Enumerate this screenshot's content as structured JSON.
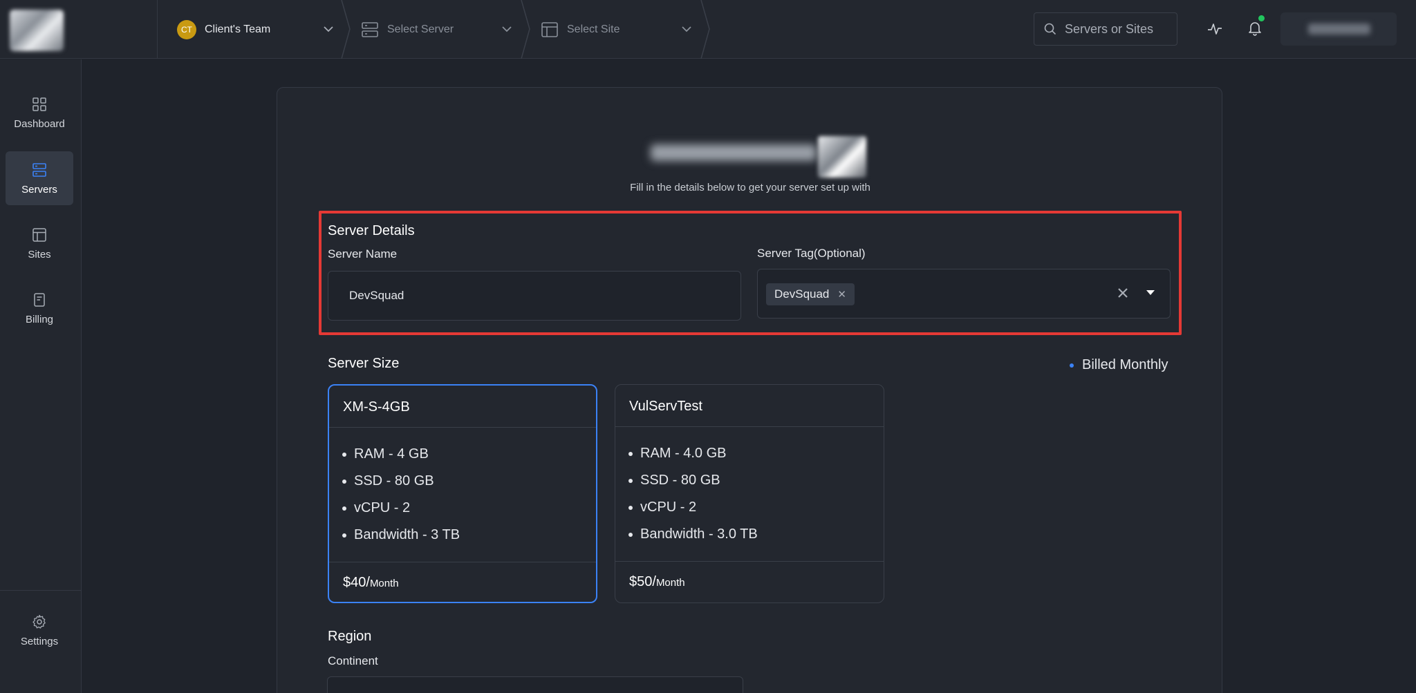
{
  "topbar": {
    "team": {
      "initials": "CT",
      "label": "Client's Team"
    },
    "server_select": {
      "label": "Select Server"
    },
    "site_select": {
      "label": "Select Site"
    },
    "search": {
      "placeholder": "Servers or Sites"
    }
  },
  "sidebar": {
    "items": [
      {
        "label": "Dashboard",
        "icon": "grid-icon"
      },
      {
        "label": "Servers",
        "icon": "server-icon",
        "active": true
      },
      {
        "label": "Sites",
        "icon": "browser-icon"
      },
      {
        "label": "Billing",
        "icon": "receipt-icon"
      }
    ],
    "settings": {
      "label": "Settings",
      "icon": "gear-icon"
    }
  },
  "main": {
    "subtitle": "Fill in the details below to get your server set up with",
    "server_details": {
      "title": "Server Details",
      "name_label": "Server Name",
      "name_value": "DevSquad",
      "tag_label": "Server Tag(Optional)",
      "tags": [
        "DevSquad"
      ]
    },
    "server_size": {
      "title": "Server Size",
      "billing": "Billed Monthly",
      "plans": [
        {
          "name": "XM-S-4GB",
          "specs": [
            "RAM - 4 GB",
            "SSD - 80 GB",
            "vCPU - 2",
            "Bandwidth - 3 TB"
          ],
          "price": "$40/",
          "period": "Month",
          "selected": true
        },
        {
          "name": "VulServTest",
          "specs": [
            "RAM - 4.0 GB",
            "SSD - 80 GB",
            "vCPU - 2",
            "Bandwidth - 3.0 TB"
          ],
          "price": "$50/",
          "period": "Month",
          "selected": false
        }
      ]
    },
    "region": {
      "title": "Region",
      "continent_label": "Continent"
    }
  },
  "colors": {
    "accent": "#3b82f6",
    "highlight": "#e53935",
    "team_badge": "#c99a12",
    "notification": "#22c55e"
  }
}
